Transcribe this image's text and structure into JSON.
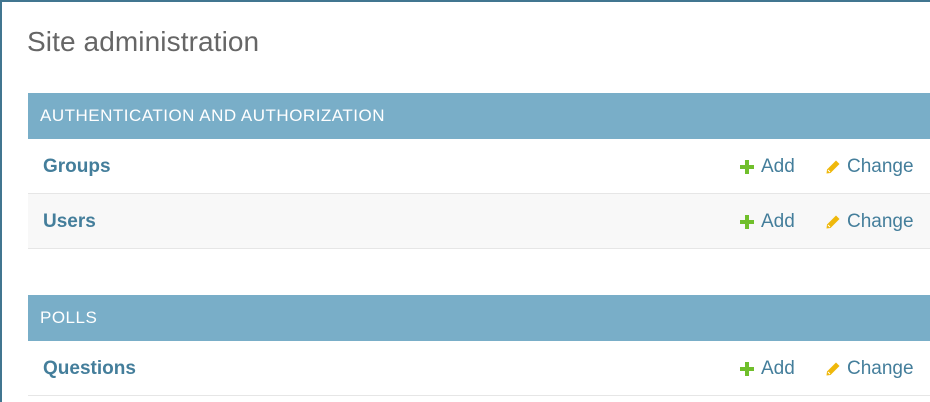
{
  "page": {
    "title": "Site administration"
  },
  "modules": [
    {
      "caption": "AUTHENTICATION AND AUTHORIZATION",
      "rows": [
        {
          "name": "Groups",
          "add_label": "Add",
          "change_label": "Change"
        },
        {
          "name": "Users",
          "add_label": "Add",
          "change_label": "Change"
        }
      ]
    },
    {
      "caption": "POLLS",
      "rows": [
        {
          "name": "Questions",
          "add_label": "Add",
          "change_label": "Change"
        }
      ]
    }
  ],
  "colors": {
    "header_bg": "#79aec8",
    "link": "#447e9b",
    "add_icon": "#70bf2b",
    "change_icon": "#efb80b",
    "title": "#666666"
  },
  "icons": {
    "add": "plus-icon",
    "change": "pencil-icon"
  }
}
